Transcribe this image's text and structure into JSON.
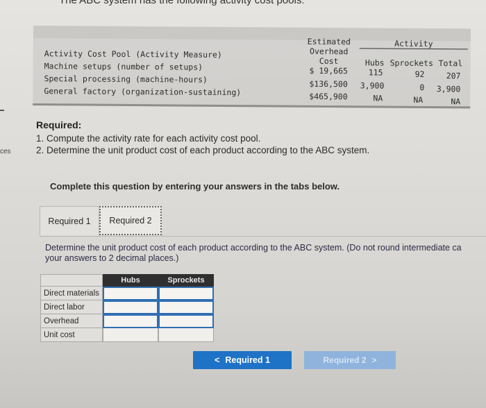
{
  "intro_text": "The ABC system has the following activity cost pools:",
  "side_text": "ces",
  "cost_pool_table": {
    "activity_header": "Activity",
    "estimated_overhead_header": [
      "Estimated",
      "Overhead",
      "Cost"
    ],
    "pool_header": "Activity Cost Pool (Activity Measure)",
    "columns": [
      "Hubs",
      "Sprockets",
      "Total"
    ],
    "rows": [
      {
        "pool": "Machine setups (number of setups)",
        "cost": "$ 19,665",
        "hubs": "115",
        "sprockets": "92",
        "total": "207"
      },
      {
        "pool": "Special processing (machine-hours)",
        "cost": "$136,500",
        "hubs": "3,900",
        "sprockets": "0",
        "total": "3,900"
      },
      {
        "pool": "General factory (organization-sustaining)",
        "cost": "$465,900",
        "hubs": "NA",
        "sprockets": "NA",
        "total": "NA"
      }
    ]
  },
  "required": {
    "title": "Required:",
    "items": [
      "1. Compute the activity rate for each activity cost pool.",
      "2. Determine the unit product cost of each product according to the ABC system."
    ]
  },
  "complete_instruction": "Complete this question by entering your answers in the tabs below.",
  "tabs": [
    {
      "label": "Required 1",
      "active": false
    },
    {
      "label": "Required 2",
      "active": true
    }
  ],
  "instruction": {
    "line1": "Determine the unit product cost of each product according to the ABC system. (Do not round intermediate ca",
    "line2": "your answers to 2 decimal places.)"
  },
  "answer_table": {
    "columns": [
      "Hubs",
      "Sprockets"
    ],
    "rows": [
      {
        "label": "Direct materials",
        "hubs": "",
        "sprockets": ""
      },
      {
        "label": "Direct labor",
        "hubs": "",
        "sprockets": ""
      },
      {
        "label": "Overhead",
        "hubs": "",
        "sprockets": ""
      },
      {
        "label": "Unit cost",
        "hubs": "",
        "sprockets": ""
      }
    ]
  },
  "nav": {
    "prev_label": "Required 1",
    "prev_icon": "<",
    "next_label": "Required 2",
    "next_icon": ">"
  }
}
